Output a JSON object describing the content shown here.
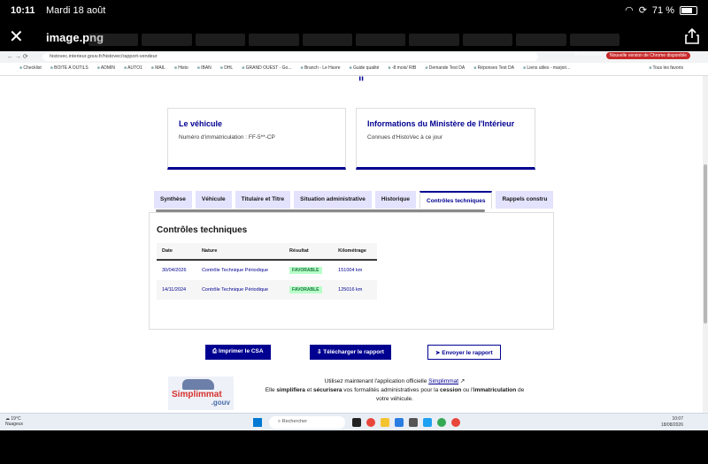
{
  "ios": {
    "time": "10:11",
    "date": "Mardi 18 août",
    "battery": "71 %"
  },
  "viewer": {
    "title": "image.png"
  },
  "browser": {
    "url": "histovec.interieur.gouv.fr/histovec/rapport-vendeur",
    "profile": "Professionnel",
    "update_notice": "Nouvelle version de Chrome disponible",
    "bookmarks": [
      "Checklist",
      "BOITE A OUTILS",
      "ADMIN",
      "AUTO1",
      "MAIL",
      "Histo",
      "IBAN",
      "DHL",
      "GRAND OUEST - Go...",
      "Branch - Le Havre",
      "Guide qualité",
      "-8 mois/ RIB",
      "Demande Test DA",
      "Réponses Test DA",
      "Liens utiles - marjori..."
    ],
    "bookmarks_all": "Tous les favoris"
  },
  "vehicle_card": {
    "title": "Le véhicule",
    "text": "Numéro d'immatriculation : FF-5**-CP"
  },
  "ministry_card": {
    "title": "Informations du Ministère de l'Intérieur",
    "text": "Connues d'HistoVec à ce jour"
  },
  "tabs": [
    {
      "label": "Synthèse"
    },
    {
      "label": "Véhicule"
    },
    {
      "label": "Titulaire et Titre"
    },
    {
      "label": "Situation administrative"
    },
    {
      "label": "Historique"
    },
    {
      "label": "Contrôles techniques",
      "active": true
    },
    {
      "label": "Rappels constru"
    }
  ],
  "controles": {
    "heading": "Contrôles techniques",
    "columns": [
      "Date",
      "Nature",
      "Résultat",
      "Kilométrage"
    ],
    "rows": [
      {
        "date": "30/04/2026",
        "nature": "Contrôle Technique Périodique",
        "result": "FAVORABLE",
        "km": "151004 km"
      },
      {
        "date": "14/11/2024",
        "nature": "Contrôle Technique Périodique",
        "result": "FAVORABLE",
        "km": "125016 km"
      }
    ]
  },
  "buttons": {
    "print": "Imprimer le CSA",
    "download": "Télécharger le rapport",
    "send": "Envoyer le rapport"
  },
  "promo": {
    "line1_prefix": "Utilisez maintenant l'application officielle ",
    "link": "Simplimmat",
    "line2_a": "Elle ",
    "simplifiera": "simplifiera",
    "line2_b": " et ",
    "securisera": "sécurisera",
    "line2_c": " vos formalités administratives pour la ",
    "cession": "cession",
    "line2_d": " ou l'",
    "immatriculation": "immatriculation",
    "line2_e": " de",
    "line3": "votre véhicule.",
    "logo_brand": "Simplimmat",
    "logo_gouv": ".gouv"
  },
  "taskbar": {
    "weather_temp": "19°C",
    "weather_text": "Nuageux",
    "search": "Rechercher",
    "time": "10:07",
    "date": "18/08/2026"
  },
  "colors": {
    "accent": "#000091",
    "favorable_bg": "#b8fec9",
    "favorable_text": "#18753c"
  }
}
